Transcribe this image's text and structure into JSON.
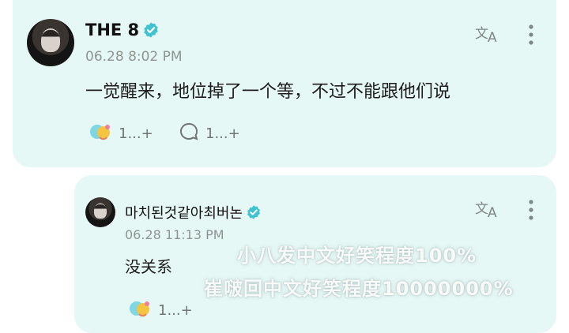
{
  "post": {
    "author": "THE 8",
    "time": "06.28 8:02 PM",
    "text": "一觉醒来，地位掉了一个等，不过不能跟他们说",
    "reactions_count": "1...+",
    "comments_count": "1...+"
  },
  "reply": {
    "author": "마치된것같아최버논",
    "time": "06.28 11:13 PM",
    "text": "没关系",
    "reactions_count": "1...+"
  },
  "overlay": {
    "line1": "小八发中文好笑程度100%",
    "line2": "崔啵回中文好笑程度10000000%"
  },
  "colors": {
    "card_bg": "#e6f8f6",
    "verified": "#3fc3d0",
    "muted_text": "#8c9592"
  },
  "icons": {
    "translate": "translate-icon",
    "more": "more-vertical-icon",
    "reaction": "reaction-emoji-icon",
    "comment": "comment-bubble-icon",
    "verified": "verified-badge-icon"
  }
}
